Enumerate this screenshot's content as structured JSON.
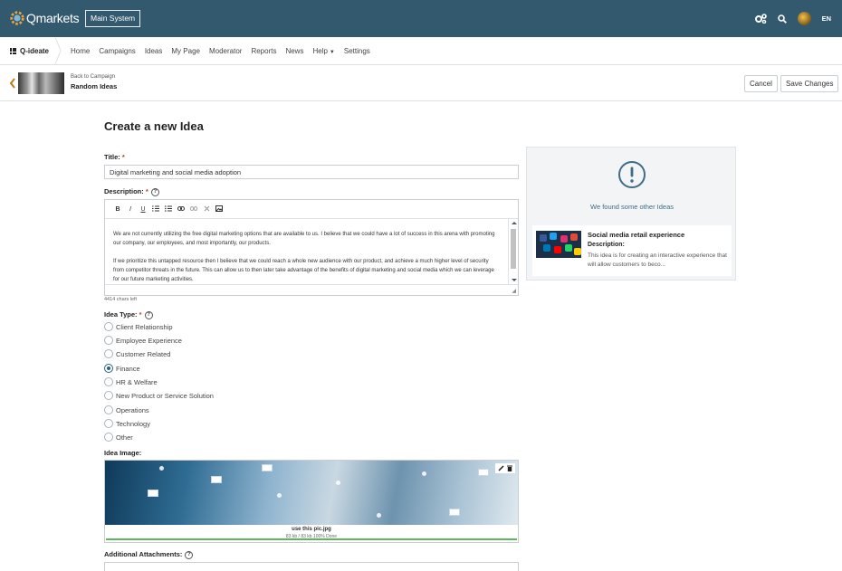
{
  "app": {
    "logo_text": "Qmarkets",
    "system_button": "Main System",
    "language": "EN",
    "icons": [
      "settings-cluster-icon",
      "search-icon",
      "avatar"
    ]
  },
  "nav": {
    "brand": "Q-ideate",
    "items": [
      "Home",
      "Campaigns",
      "Ideas",
      "My Page",
      "Moderator",
      "Reports",
      "News",
      "Help",
      "Settings"
    ]
  },
  "subheader": {
    "back_text": "Back to Campaign",
    "campaign": "Random Ideas",
    "cancel_label": "Cancel",
    "save_label": "Save Changes"
  },
  "form": {
    "page_title": "Create a new Idea",
    "title_label": "Title:",
    "title_value": "Digital marketing and social media adoption",
    "description_label": "Description:",
    "description_paragraphs": [
      "We are not currently utilizing the free digital marketing options that are available to us. I believe that we could have a lot of success in this arena with promoting our company, our employees, and most importantly, our products.",
      "If we prioritize this untapped resource then I believe that we could reach a whole new audience with our product, and achieve a much higher level of security from competitor threats in the future. This can allow us to then later take advantage of the benefits of digital marketing and social media which we can leverage for our future marketing activities."
    ],
    "chars_left": "4414 chars left",
    "idea_type_label": "Idea Type:",
    "idea_types": [
      "Client Relationship",
      "Employee Experience",
      "Customer Related",
      "Finance",
      "HR & Welfare",
      "New Product or Service Solution",
      "Operations",
      "Technology",
      "Other"
    ],
    "selected_idea_type": "Finance",
    "image_label": "Idea Image:",
    "image_filename": "use this pic.jpg",
    "image_progress_text": "83 kb / 83 kb 100% Done",
    "image_progress": 1.0,
    "attachments_label": "Additional Attachments:",
    "toolbar_icons": [
      "bold-icon",
      "italic-icon",
      "underline-icon",
      "ordered-list-icon",
      "unordered-list-icon",
      "link-icon",
      "unlink-icon",
      "remove-format-icon",
      "image-icon"
    ]
  },
  "side_panel": {
    "found_text": "We found some other Ideas",
    "card_title": "Social media retail experience",
    "card_desc_label": "Description:",
    "card_desc": "This idea is for creating an interactive experience that will allow customers to beco..."
  },
  "colors": {
    "topbar": "#33596e",
    "accent": "#3f6c86",
    "required": "#c0392b",
    "progress": "#5cb85c"
  }
}
